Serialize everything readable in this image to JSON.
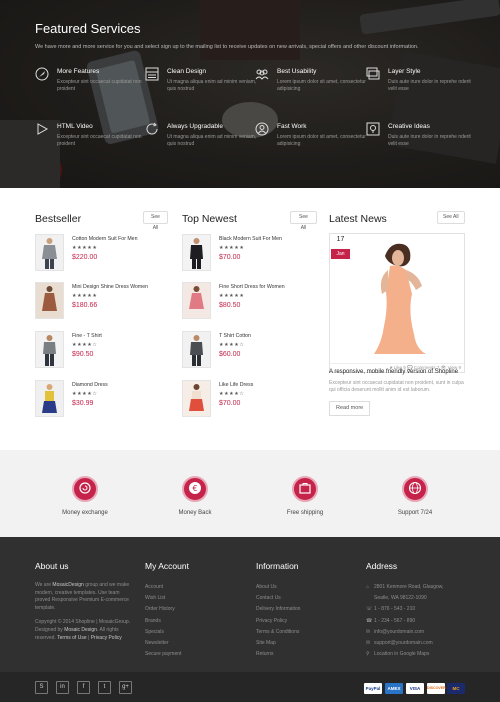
{
  "featured": {
    "title": "Featured Services",
    "subtitle": "We have more and more service for you and select sign up to the mailing list to receive updates on new arrivals, special offers and other discount information.",
    "items": [
      {
        "icon": "rocket-icon",
        "title": "More Features",
        "desc": "Excepteur sint occaecat cupidatat non proident"
      },
      {
        "icon": "layout-icon",
        "title": "Clean Design",
        "desc": "Ut magna aliqua enim ad minim veniam, quis nostrud"
      },
      {
        "icon": "users-icon",
        "title": "Best Usability",
        "desc": "Lorem ipsum dolor sit amet, consectetur adipisicing"
      },
      {
        "icon": "layers-icon",
        "title": "Layer Style",
        "desc": "Duis aute irure dolor in reprehe nderit velit esse"
      },
      {
        "icon": "play-icon",
        "title": "HTML Video",
        "desc": "Excepteur sint occaecat cupidatat non proident"
      },
      {
        "icon": "refresh-icon",
        "title": "Always Upgradable",
        "desc": "Ut magna aliqua enim ad minim veniam, quis nostrud"
      },
      {
        "icon": "support-icon",
        "title": "Fast Work",
        "desc": "Lorem ipsum dolor sit amet, consectetur adipisicing"
      },
      {
        "icon": "bulb-icon",
        "title": "Creative Ideas",
        "desc": "Duis aute irure dolor in reprehe nderit velit esse"
      }
    ]
  },
  "bestseller": {
    "title": "Bestseller",
    "see_all": "See All",
    "products": [
      {
        "name": "Cotton Modern Suit For Men",
        "stars": "★★★★★",
        "price": "$220.00"
      },
      {
        "name": "Mini Design Shine Dress Women",
        "stars": "★★★★★",
        "price": "$180.66"
      },
      {
        "name": "Fine - T Shirt",
        "stars": "★★★★☆",
        "price": "$90.50"
      },
      {
        "name": "Diamond Dress",
        "stars": "★★★★☆",
        "price": "$30.99"
      }
    ]
  },
  "top_newest": {
    "title": "Top Newest",
    "see_all": "See All",
    "products": [
      {
        "name": "Black Modern Suit For Men",
        "stars": "★★★★★",
        "price": "$70.00"
      },
      {
        "name": "Fine Short Dress for Women",
        "stars": "★★★★★",
        "price": "$80.50"
      },
      {
        "name": "T Shirt Cotton",
        "stars": "★★★★☆",
        "price": "$60.00"
      },
      {
        "name": "Like Life Dress",
        "stars": "★★★★☆",
        "price": "$70.00"
      }
    ]
  },
  "latest_news": {
    "title": "Latest News",
    "see_all": "See All",
    "day": "17",
    "month": "Jan",
    "meta": "♥ Like 9   💬 Comments 7   👁 View 9",
    "post_title": "A responsive, mobile friendly version of Shopline",
    "post_text": "Excepteur sint occaecat cupidatat non proident, sunt in culpa qui officia deserunt mollit anim id est laborum.",
    "read_more": "Read more"
  },
  "services": [
    {
      "icon": "money-exchange-icon",
      "label": "Money exchange"
    },
    {
      "icon": "euro-icon",
      "label": "Money Back"
    },
    {
      "icon": "shipping-icon",
      "label": "Free shipping"
    },
    {
      "icon": "globe-icon",
      "label": "Support 7/24"
    }
  ],
  "footer": {
    "about": {
      "title": "About us",
      "text_pre": "We are ",
      "text_brand": "MosaicDesign",
      "text_post": " group and we make modern, creative templates. Use team proved Responsive Premium E-commerce template.",
      "copyright": "Copyright © 2014 Shopline | MosaicGroup. Designed by ",
      "copyright_brand": "Mosaic Design",
      "copyright_rest": ". All rights reserved. ",
      "terms": "Terms of Use",
      "sep": " | ",
      "privacy": "Privacy Policy"
    },
    "account": {
      "title": "My Account",
      "links": [
        "Account",
        "Wish List",
        "Order History",
        "Brands",
        "Specials",
        "Newsletter",
        "Secure payment"
      ]
    },
    "information": {
      "title": "Information",
      "links": [
        "About Us",
        "Contact Us",
        "Delivery Information",
        "Privacy Policy",
        "Terms & Conditions",
        "Site Map",
        "Returns"
      ]
    },
    "address": {
      "title": "Address",
      "street": "2801 Kenmore Road, Glasgow,",
      "city": "Seatle, WA 98122-1090",
      "phone": "1 - 876 - 543 - 210",
      "fax": "1 - 234 - 567 - 890",
      "email": "info@yourdomain.com",
      "support": "support@yourdomain.com",
      "map": "Location in Google Maps"
    }
  },
  "social": [
    "Skype",
    "in",
    "f",
    "t",
    "g+"
  ],
  "payments": [
    "PayPal",
    "AMEX",
    "VISA",
    "DISCOVER",
    "MC"
  ],
  "colors": {
    "accent": "#c5234a",
    "footer": "#303030",
    "band": "#f2f2f2"
  }
}
